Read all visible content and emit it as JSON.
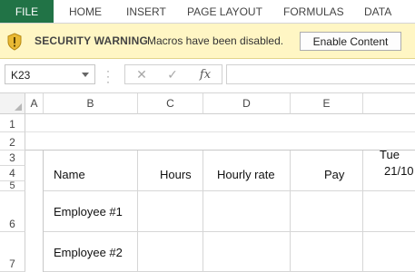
{
  "ribbon": {
    "file_label": "FILE",
    "tabs": [
      "HOME",
      "INSERT",
      "PAGE LAYOUT",
      "FORMULAS",
      "DATA"
    ]
  },
  "security_bar": {
    "title": "SECURITY WARNING",
    "message": "Macros have been disabled.",
    "button_label": "Enable Content",
    "icon": "shield-warning-icon"
  },
  "formula_bar": {
    "name_box": "K23",
    "cancel_icon": "✕",
    "enter_icon": "✓",
    "fx_label": "fx",
    "formula_value": ""
  },
  "grid": {
    "columns": [
      "A",
      "B",
      "C",
      "D",
      "E"
    ],
    "rows": [
      "1",
      "2",
      "3",
      "4",
      "5",
      "6",
      "7"
    ],
    "headers": {
      "name": "Name",
      "hours": "Hours",
      "hourly_rate": "Hourly rate",
      "pay": "Pay",
      "date_line1": "Tue",
      "date_line2": "21/10"
    },
    "employees": [
      "Employee #1",
      "Employee #2"
    ]
  },
  "colors": {
    "accent": "#217346",
    "warning_bg": "#fff6c4"
  }
}
